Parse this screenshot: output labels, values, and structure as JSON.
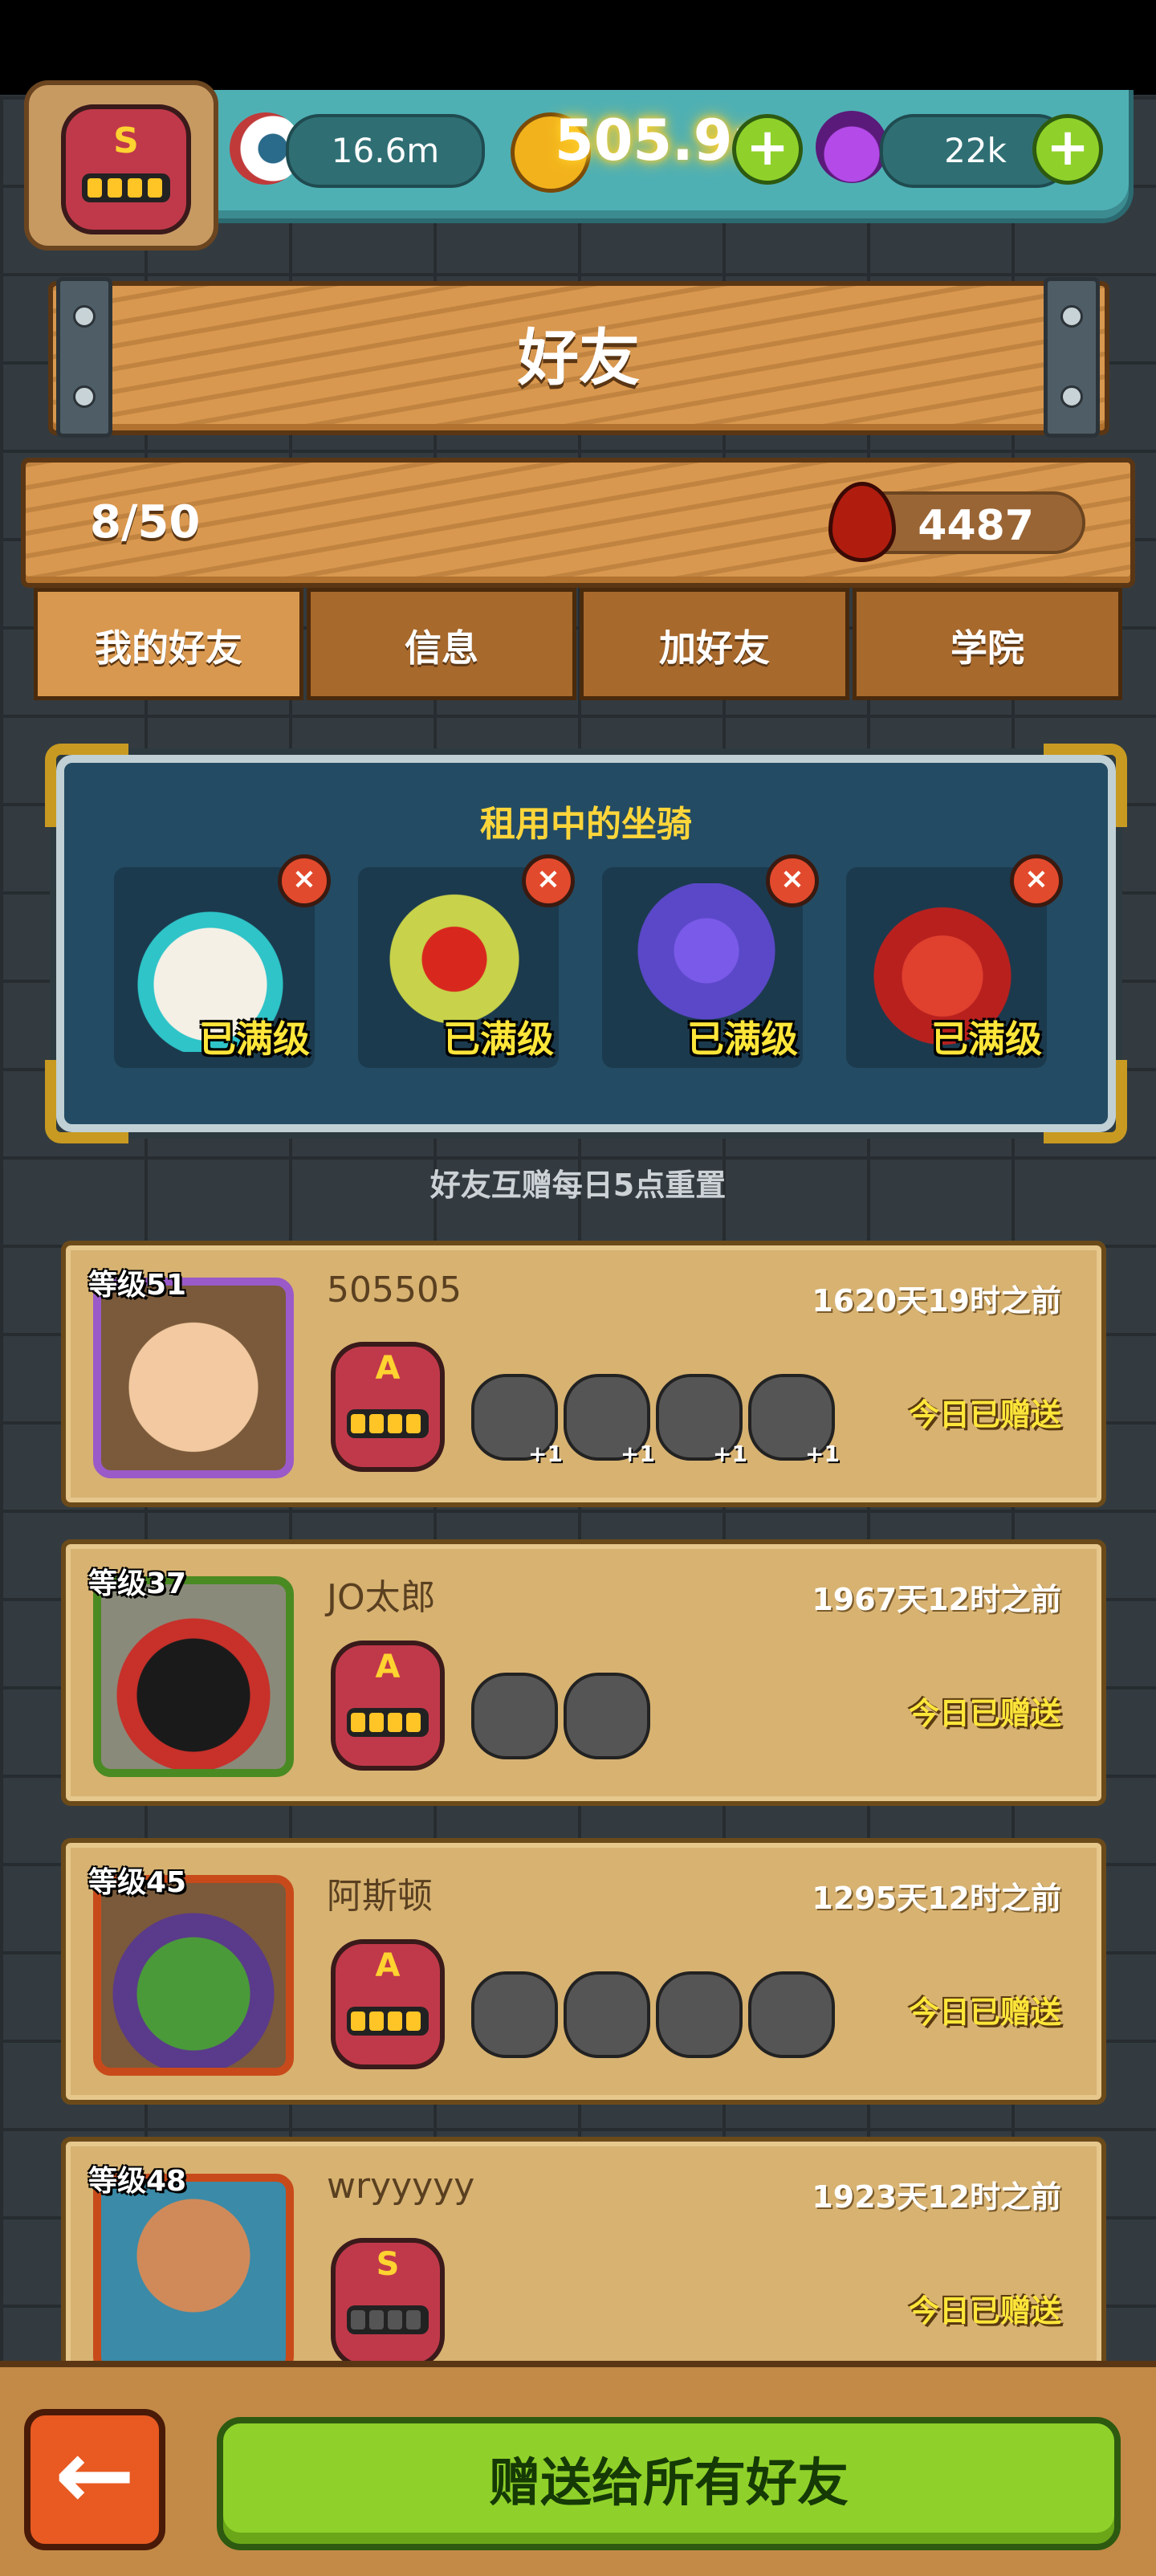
{
  "header": {
    "eye_currency": "16.6m",
    "coin_currency": "505.9n",
    "potion_currency": "22k",
    "badge_letter": "S"
  },
  "page": {
    "title": "好友",
    "friend_count": "8/50",
    "blood_points": "4487"
  },
  "tabs": [
    {
      "label": "我的好友",
      "active": true
    },
    {
      "label": "信息",
      "active": false
    },
    {
      "label": "加好友",
      "active": false
    },
    {
      "label": "学院",
      "active": false
    }
  ],
  "mounts": {
    "title": "租用中的坐骑",
    "items": [
      {
        "status": "已满级",
        "color": "#f4f0e6"
      },
      {
        "status": "已满级",
        "color": "#c8d24a"
      },
      {
        "status": "已满级",
        "color": "#5a48c8"
      },
      {
        "status": "已满级",
        "color": "#b8201e"
      }
    ]
  },
  "reset_note": "好友互赠每日5点重置",
  "friends": [
    {
      "level": "等级51",
      "name": "505505",
      "time": "1620天19时之前",
      "status": "今日已赠送",
      "rank": "A",
      "frame": "#9a5ac8",
      "mounts": [
        "+1",
        "+1",
        "+1",
        "+1"
      ]
    },
    {
      "level": "等级37",
      "name": "JO太郎",
      "time": "1967天12时之前",
      "status": "今日已赠送",
      "rank": "A",
      "frame": "#4a8a22",
      "mounts": [
        "",
        ""
      ]
    },
    {
      "level": "等级45",
      "name": "阿斯顿",
      "time": "1295天12时之前",
      "status": "今日已赠送",
      "rank": "A",
      "frame": "#c84a1a",
      "mounts": [
        "",
        "",
        "",
        ""
      ]
    },
    {
      "level": "等级48",
      "name": "wryyyyy",
      "time": "1923天12时之前",
      "status": "今日已赠送",
      "rank": "S",
      "frame": "#c84a1a",
      "mounts": []
    }
  ],
  "actions": {
    "gift_all": "赠送给所有好友",
    "back_arrow": "←"
  }
}
